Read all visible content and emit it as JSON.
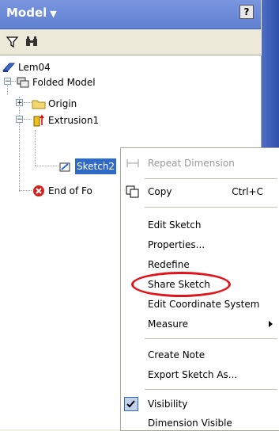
{
  "panel": {
    "title": "Model",
    "help_label": "?"
  },
  "toolbar": {
    "filter_icon": "filter-icon",
    "find_icon": "binoculars-icon"
  },
  "tree": {
    "root": "Lem04",
    "folded_model": "Folded Model",
    "origin": "Origin",
    "extrusion": "Extrusion1",
    "sketch": "Sketch2",
    "end_of_part": "End of Fo"
  },
  "context_menu": {
    "repeat_dimension": "Repeat Dimension",
    "copy": "Copy",
    "copy_shortcut": "Ctrl+C",
    "edit_sketch": "Edit Sketch",
    "properties": "Properties...",
    "redefine": "Redefine",
    "share_sketch": "Share Sketch",
    "edit_coordinate_system": "Edit Coordinate System",
    "measure": "Measure",
    "create_note": "Create Note",
    "export_sketch_as": "Export Sketch As...",
    "visibility": "Visibility",
    "partial_item": "Dimension Visible"
  },
  "colors": {
    "header_blue": "#6a88d8",
    "selection_blue": "#316ac5",
    "annotation_red": "#e0141a"
  }
}
